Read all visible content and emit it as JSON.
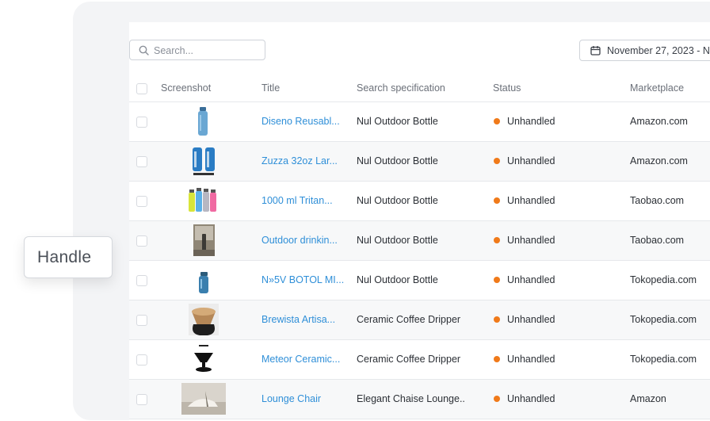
{
  "search": {
    "placeholder": "Search..."
  },
  "date_filter": {
    "label": "November 27, 2023 - N"
  },
  "table": {
    "columns": [
      "Screenshot",
      "Title",
      "Search specification",
      "Status",
      "Marketplace"
    ],
    "rows": [
      {
        "title": "Diseno Reusabl...",
        "spec": "Nul Outdoor Bottle",
        "status": "Unhandled",
        "marketplace": "Amazon.com"
      },
      {
        "title": "Zuzza 32oz Lar...",
        "spec": "Nul Outdoor Bottle",
        "status": "Unhandled",
        "marketplace": "Amazon.com"
      },
      {
        "title": "1000 ml Tritan...",
        "spec": "Nul Outdoor Bottle",
        "status": "Unhandled",
        "marketplace": "Taobao.com"
      },
      {
        "title": "Outdoor drinkin...",
        "spec": "Nul Outdoor Bottle",
        "status": "Unhandled",
        "marketplace": "Taobao.com"
      },
      {
        "title": "N»5V BOTOL MI...",
        "spec": "Nul Outdoor Bottle",
        "status": "Unhandled",
        "marketplace": "Tokopedia.com"
      },
      {
        "title": "Brewista Artisa...",
        "spec": "Ceramic Coffee Dripper",
        "status": "Unhandled",
        "marketplace": "Tokopedia.com"
      },
      {
        "title": "Meteor Ceramic...",
        "spec": "Ceramic Coffee Dripper",
        "status": "Unhandled",
        "marketplace": "Tokopedia.com"
      },
      {
        "title": "Lounge Chair",
        "spec": "Elegant Chaise Lounge..",
        "status": "Unhandled",
        "marketplace": "Amazon"
      }
    ]
  },
  "tooltip": {
    "label": "Handle"
  },
  "colors": {
    "link": "#2f8fd8",
    "status_unhandled": "#f07a1a"
  }
}
